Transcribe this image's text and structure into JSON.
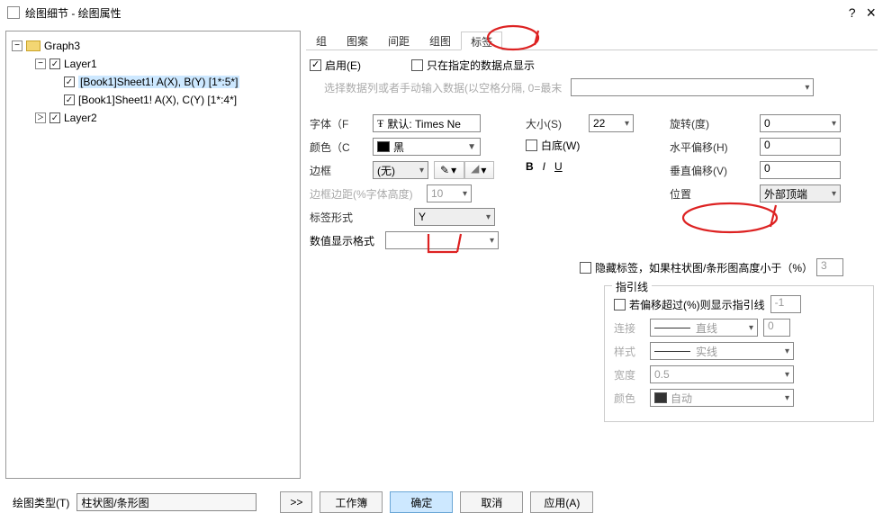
{
  "window": {
    "title": "绘图细节 - 绘图属性",
    "help": "?",
    "close": "×"
  },
  "tree": {
    "root": "Graph3",
    "layer1": "Layer1",
    "layer2": "Layer2",
    "item1": "[Book1]Sheet1! A(X), B(Y) [1*:5*]",
    "item2": "[Book1]Sheet1! A(X), C(Y) [1*:4*]"
  },
  "tabs": {
    "t0": "组",
    "t1": "图案",
    "t2": "间距",
    "t3": "组图",
    "t4": "标签"
  },
  "p": {
    "enable": "启用(E)",
    "onlyShow": "只在指定的数据点显示",
    "subhint": "选择数据列或者手动输入数据(以空格分隔, 0=最末",
    "font_lbl": "字体（F",
    "font_val": "默认: Times Ne",
    "color_lbl": "颜色（C",
    "color_val": "黑",
    "border_lbl": "边框",
    "border_val": "(无)",
    "borderMargin": "边框边距(%字体高度)",
    "borderMargin_val": "10",
    "labelform_lbl": "标签形式",
    "labelform_val": "Y",
    "numfmt_lbl": "数值显示格式",
    "size_lbl": "大小(S)",
    "size_val": "22",
    "whitebg": "白底(W)",
    "rotate_lbl": "旋转(度)",
    "rotate_val": "0",
    "hoff_lbl": "水平偏移(H)",
    "hoff_val": "0",
    "voff_lbl": "垂直偏移(V)",
    "voff_val": "0",
    "pos_lbl": "位置",
    "pos_val": "外部顶端",
    "hideLabel": "隐藏标签，如果柱状图/条形图高度小于（%）",
    "hideLabel_val": "3"
  },
  "leader": {
    "title": "指引线",
    "show": "若偏移超过(%)则显示指引线",
    "show_val": "-1",
    "connect_l": "连接",
    "connect_v": "直线",
    "connect_n": "0",
    "style_l": "样式",
    "style_v": "实线",
    "width_l": "宽度",
    "width_v": "0.5",
    "color_l": "颜色",
    "color_v": "自动"
  },
  "footer": {
    "type_lbl": "绘图类型(T)",
    "type_val": "柱状图/条形图",
    "arrows": ">>",
    "workbook": "工作簿",
    "ok": "确定",
    "cancel": "取消",
    "apply": "应用(A)"
  }
}
